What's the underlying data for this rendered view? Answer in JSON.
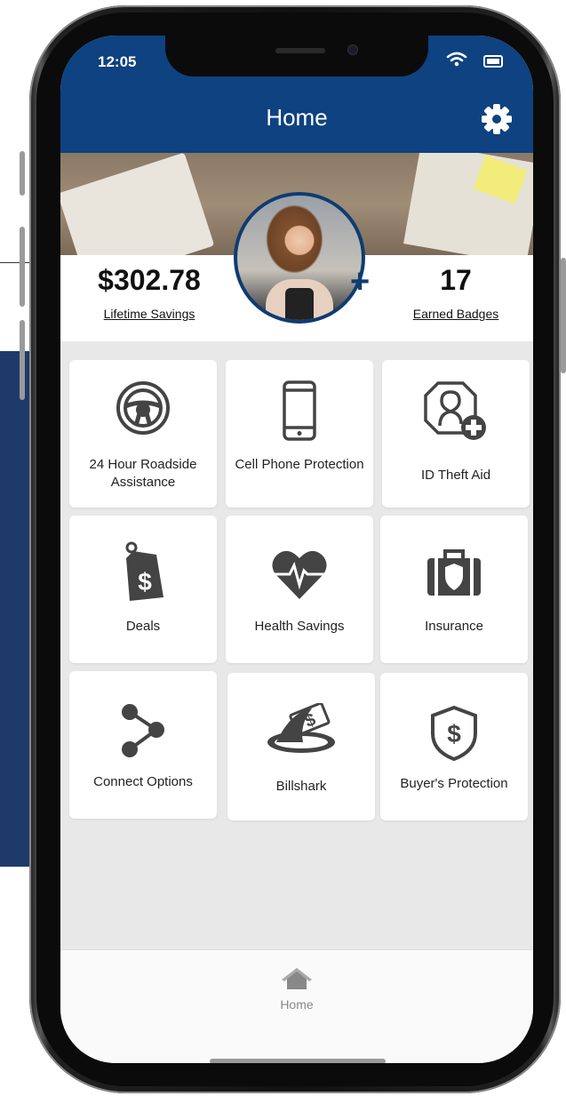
{
  "status_bar": {
    "time": "12:05"
  },
  "header": {
    "title": "Home"
  },
  "stats": {
    "savings_value": "$302.78",
    "savings_label": "Lifetime Savings",
    "badges_value": "17",
    "badges_label": "Earned Badges"
  },
  "tiles": [
    {
      "label": "24 Hour Roadside Assistance",
      "icon": "steering-wheel-icon"
    },
    {
      "label": "Cell Phone Protection",
      "icon": "cell-phone-icon"
    },
    {
      "label": "ID Theft Aid",
      "icon": "id-theft-icon"
    },
    {
      "label": "Deals",
      "icon": "price-tag-icon"
    },
    {
      "label": "Health Savings",
      "icon": "heart-pulse-icon"
    },
    {
      "label": "Insurance",
      "icon": "briefcase-shield-icon"
    },
    {
      "label": "Connect Options",
      "icon": "share-icon"
    },
    {
      "label": "Billshark",
      "icon": "shark-fin-icon"
    },
    {
      "label": "Buyer's Protection",
      "icon": "shield-dollar-icon"
    }
  ],
  "tabbar": {
    "home_label": "Home"
  },
  "colors": {
    "header_bg": "#0e4280",
    "icon_gray": "#444444",
    "screen_bg": "#e8e8e8"
  }
}
